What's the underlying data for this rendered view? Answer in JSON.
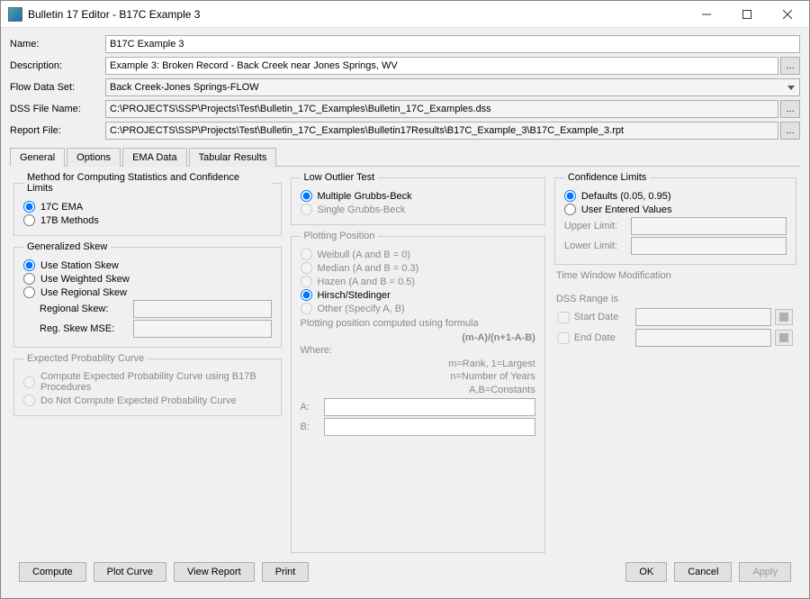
{
  "window": {
    "title": "Bulletin 17 Editor - B17C Example 3"
  },
  "labels": {
    "name": "Name:",
    "description": "Description:",
    "flowDataSet": "Flow Data Set:",
    "dssFileName": "DSS File Name:",
    "reportFile": "Report File:"
  },
  "fields": {
    "name": "B17C Example 3",
    "description": "Example 3: Broken Record - Back Creek near Jones Springs, WV",
    "flowDataSet": "Back Creek-Jones Springs-FLOW",
    "dssFileName": "C:\\PROJECTS\\SSP\\Projects\\Test\\Bulletin_17C_Examples\\Bulletin_17C_Examples.dss",
    "reportFile": "C:\\PROJECTS\\SSP\\Projects\\Test\\Bulletin_17C_Examples\\Bulletin17Results\\B17C_Example_3\\B17C_Example_3.rpt"
  },
  "tabs": {
    "general": "General",
    "options": "Options",
    "emaData": "EMA Data",
    "tabularResults": "Tabular Results"
  },
  "method": {
    "legend": "Method for Computing Statistics and Confidence Limits",
    "ema": "17C EMA",
    "b17b": "17B Methods"
  },
  "skew": {
    "legend": "Generalized Skew",
    "station": "Use Station Skew",
    "weighted": "Use Weighted Skew",
    "regional": "Use Regional Skew",
    "regSkew": "Regional Skew:",
    "regMse": "Reg. Skew MSE:"
  },
  "epc": {
    "legend": "Expected Probablity Curve",
    "compute": "Compute Expected Probability Curve using B17B Procedures",
    "noCompute": "Do Not Compute Expected Probability Curve"
  },
  "lot": {
    "legend": "Low Outlier Test",
    "multiple": "Multiple Grubbs-Beck",
    "single": "Single Grubbs-Beck"
  },
  "pp": {
    "legend": "Plotting Position",
    "weibull": "Weibull (A and B = 0)",
    "median": "Median (A and B = 0.3)",
    "hazen": "Hazen (A and B = 0.5)",
    "hirsch": "Hirsch/Stedinger",
    "other": "Other (Specify A, B)",
    "formulaIntro": "Plotting position computed using formula",
    "formula": "(m-A)/(n+1-A-B)",
    "where": "Where:",
    "def1": "m=Rank, 1=Largest",
    "def2": "n=Number of Years",
    "def3": "A,B=Constants",
    "a": "A:",
    "b": "B:"
  },
  "cl": {
    "legend": "Confidence Limits",
    "defaults": "Defaults (0.05, 0.95)",
    "user": "User Entered Values",
    "upper": "Upper Limit:",
    "lower": "Lower Limit:"
  },
  "tw": {
    "legend": "Time Window Modification",
    "range": "DSS Range is",
    "start": "Start Date",
    "end": "End Date"
  },
  "buttons": {
    "compute": "Compute",
    "plot": "Plot Curve",
    "view": "View Report",
    "print": "Print",
    "ok": "OK",
    "cancel": "Cancel",
    "apply": "Apply"
  }
}
